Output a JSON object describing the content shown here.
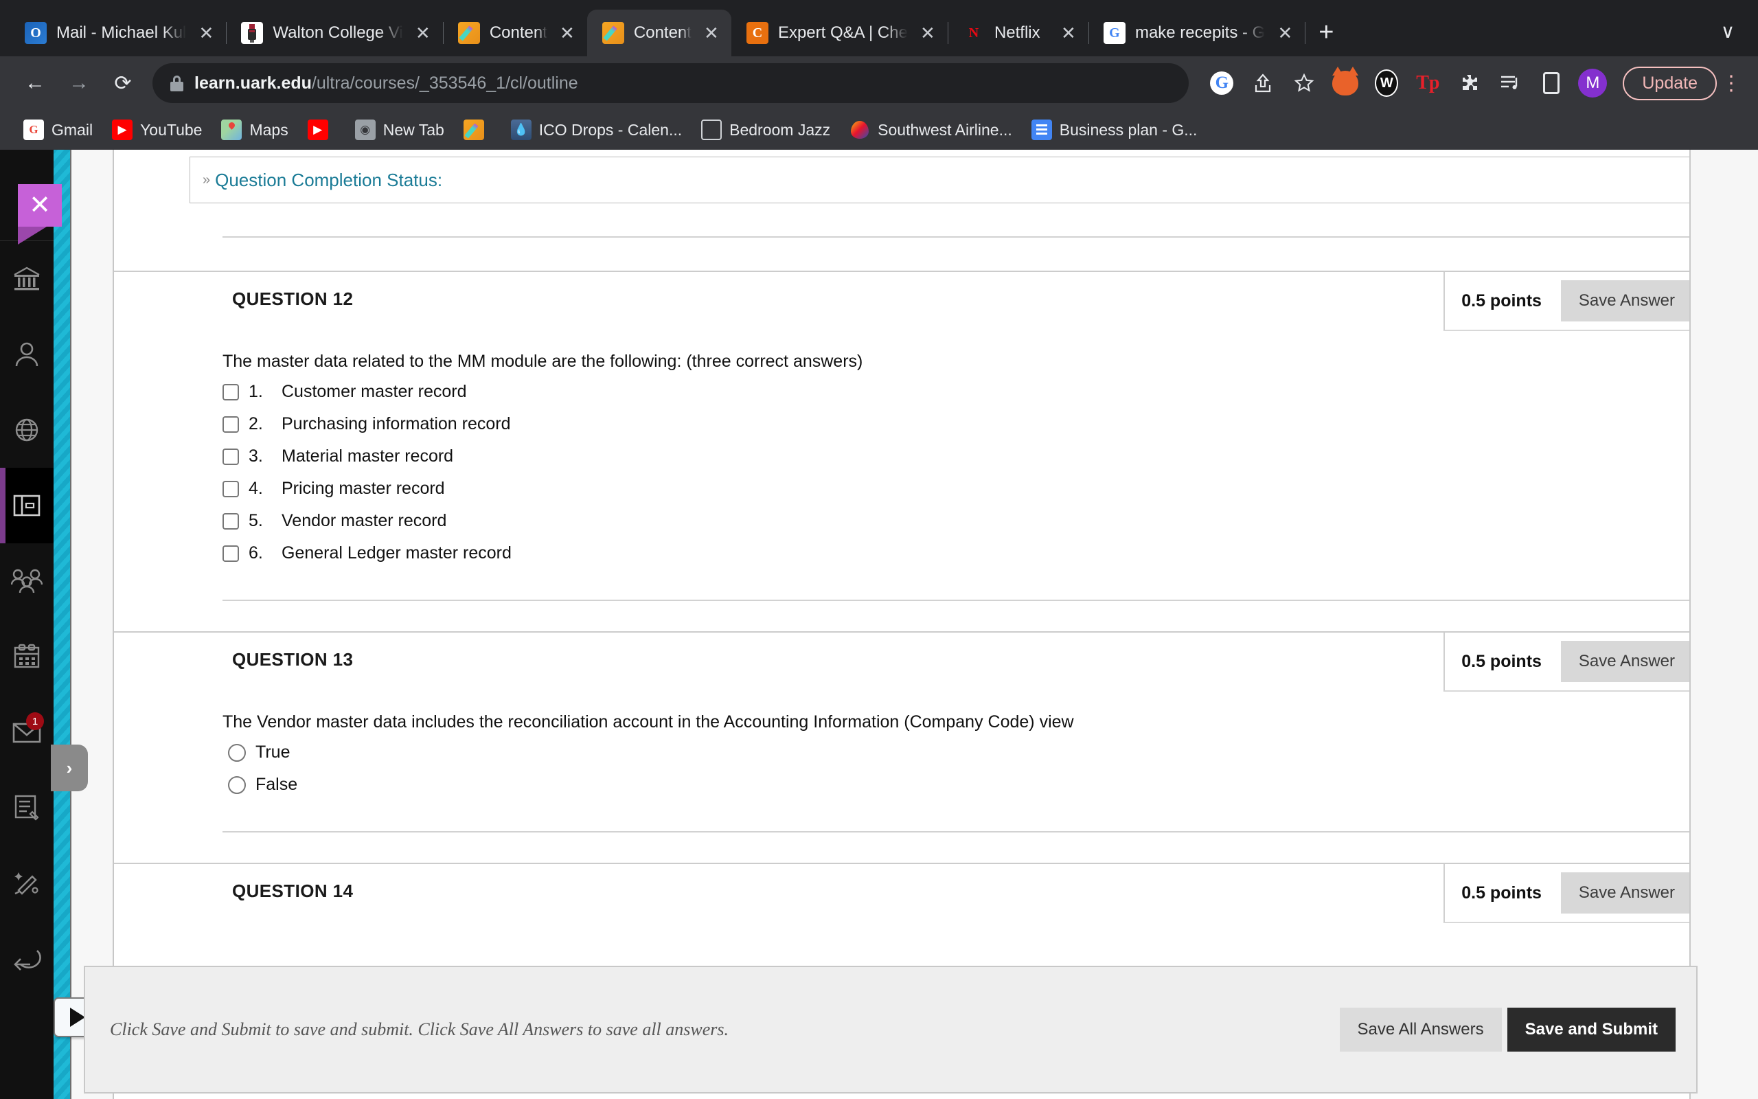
{
  "browser": {
    "tabs": [
      {
        "label": "Mail - Michael Kul",
        "icon": "outlook-icon",
        "active": false
      },
      {
        "label": "Walton College Vi",
        "icon": "walton-college-icon",
        "active": false
      },
      {
        "label": "Content",
        "icon": "blackboard-pencil-icon",
        "active": false
      },
      {
        "label": "Content",
        "icon": "blackboard-pencil-icon",
        "active": true
      },
      {
        "label": "Expert Q&A | Che",
        "icon": "chegg-icon",
        "active": false
      },
      {
        "label": "Netflix",
        "icon": "netflix-icon",
        "active": false
      },
      {
        "label": "make recepits - G",
        "icon": "google-icon",
        "active": false
      }
    ],
    "new_tab_label": "+",
    "tab_list_chevron": "∨",
    "close_glyph": "✕",
    "nav": {
      "back": "←",
      "forward": "→",
      "reload": "⟳"
    },
    "omnibox": {
      "url_bold": "learn.uark.edu",
      "url_rest": "/ultra/courses/_353546_1/cl/outline",
      "lock": "lock-icon"
    },
    "toolbar_icons": [
      "google-account-icon",
      "share-icon",
      "bookmark-star-icon",
      "metamask-fox-icon",
      "wayback-machine-icon",
      "teacherspayteachers-icon",
      "extensions-puzzle-icon",
      "playlist-icon",
      "side-panel-icon"
    ],
    "profile_initial": "M",
    "update_label": "Update",
    "kebab": "⋮",
    "bookmarks": [
      {
        "label": "Gmail",
        "icon": "gmail-icon"
      },
      {
        "label": "YouTube",
        "icon": "youtube-icon"
      },
      {
        "label": "Maps",
        "icon": "maps-icon"
      },
      {
        "label": "",
        "icon": "youtube-icon"
      },
      {
        "label": "New Tab",
        "icon": "newtab-icon"
      },
      {
        "label": "",
        "icon": "blackboard-pencil-icon"
      },
      {
        "label": "ICO Drops - Calen...",
        "icon": "ico-drops-icon"
      },
      {
        "label": "Bedroom Jazz",
        "icon": "folder-icon"
      },
      {
        "label": "Southwest Airline...",
        "icon": "southwest-icon"
      },
      {
        "label": "Business plan - G...",
        "icon": "google-docs-icon"
      }
    ]
  },
  "rail": {
    "logo_glyph": "✕",
    "items": [
      {
        "name": "institution-icon",
        "selected": false
      },
      {
        "name": "profile-icon",
        "selected": false
      },
      {
        "name": "globe-icon",
        "selected": false
      },
      {
        "name": "courses-icon",
        "selected": true
      },
      {
        "name": "organizations-icon",
        "selected": false
      },
      {
        "name": "calendar-icon",
        "selected": false
      },
      {
        "name": "messages-icon",
        "selected": false,
        "badge": "1"
      },
      {
        "name": "grades-icon",
        "selected": false
      },
      {
        "name": "tools-icon",
        "selected": false
      },
      {
        "name": "sign-out-icon",
        "selected": false
      }
    ],
    "expand_glyph": "›"
  },
  "page": {
    "completion_status": {
      "toggle_glyph": "»",
      "label": "Question Completion Status:"
    },
    "questions": [
      {
        "title": "QUESTION 12",
        "points": "0.5 points",
        "save_label": "Save Answer",
        "prompt": "The master data related to the MM module are the following: (three correct answers)",
        "type": "checkbox",
        "options": [
          {
            "num": "1.",
            "text": "Customer master record"
          },
          {
            "num": "2.",
            "text": "Purchasing information record"
          },
          {
            "num": "3.",
            "text": "Material master record"
          },
          {
            "num": "4.",
            "text": "Pricing master record"
          },
          {
            "num": "5.",
            "text": "Vendor master record"
          },
          {
            "num": "6.",
            "text": "General Ledger master record"
          }
        ]
      },
      {
        "title": "QUESTION 13",
        "points": "0.5 points",
        "save_label": "Save Answer",
        "prompt": "The Vendor master data includes the reconciliation account in the Accounting Information (Company Code) view",
        "type": "radio",
        "options": [
          {
            "num": "",
            "text": "True"
          },
          {
            "num": "",
            "text": "False"
          }
        ]
      },
      {
        "title": "QUESTION 14",
        "points": "0.5 points",
        "save_label": "Save Answer",
        "prompt": "",
        "type": "none",
        "options": []
      }
    ],
    "save_bar": {
      "note": "Click Save and Submit to save and submit. Click Save All Answers to save all answers.",
      "save_all_label": "Save All Answers",
      "save_submit_label": "Save and Submit"
    }
  }
}
